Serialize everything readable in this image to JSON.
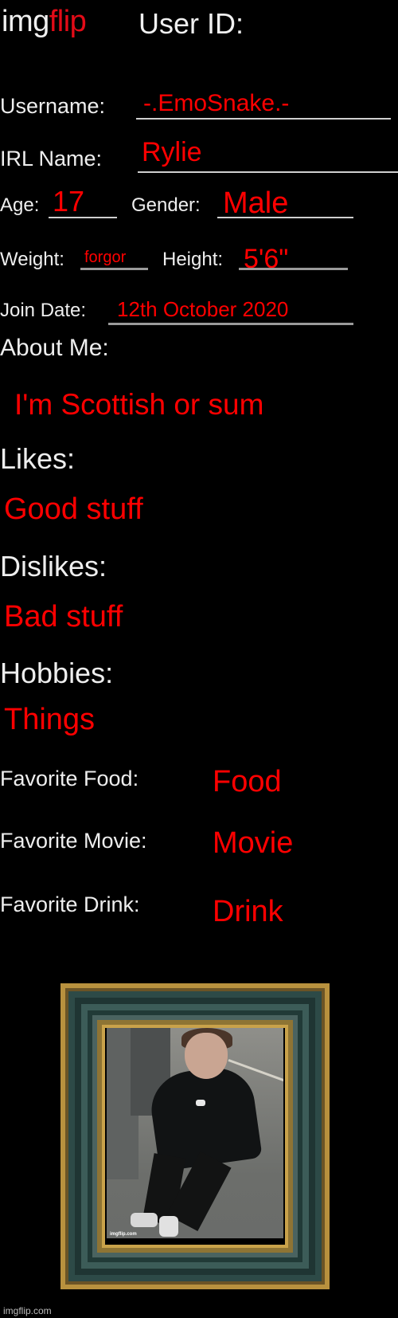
{
  "header": {
    "logo_part1": "img",
    "logo_part2": "flip",
    "title": "User ID:"
  },
  "fields": {
    "username": {
      "label": "Username:",
      "value": "-.EmoSnake.-"
    },
    "irl_name": {
      "label": "IRL Name:",
      "value": "Rylie"
    },
    "age": {
      "label": "Age:",
      "value": "17"
    },
    "gender": {
      "label": "Gender:",
      "value": "Male"
    },
    "weight": {
      "label": "Weight:",
      "value": "forgor"
    },
    "height": {
      "label": "Height:",
      "value": "5'6\""
    },
    "join_date": {
      "label": "Join Date:",
      "value": "12th October 2020"
    }
  },
  "sections": {
    "about_me": {
      "label": "About Me:",
      "value": "I'm Scottish or sum"
    },
    "likes": {
      "label": "Likes:",
      "value": "Good stuff"
    },
    "dislikes": {
      "label": "Dislikes:",
      "value": "Bad stuff"
    },
    "hobbies": {
      "label": "Hobbies:",
      "value": "Things"
    }
  },
  "favorites": {
    "food": {
      "label": "Favorite Food:",
      "value": "Food"
    },
    "movie": {
      "label": "Favorite Movie:",
      "value": "Movie"
    },
    "drink": {
      "label": "Favorite Drink:",
      "value": "Drink"
    }
  },
  "photo": {
    "watermark": "imgflip.com"
  },
  "footer": {
    "watermark": "imgflip.com"
  },
  "colors": {
    "background": "#000000",
    "label_text": "#eeeeee",
    "value_text": "#ff0000",
    "brand_red": "#e30b17",
    "frame_gold": "#b8913e"
  }
}
